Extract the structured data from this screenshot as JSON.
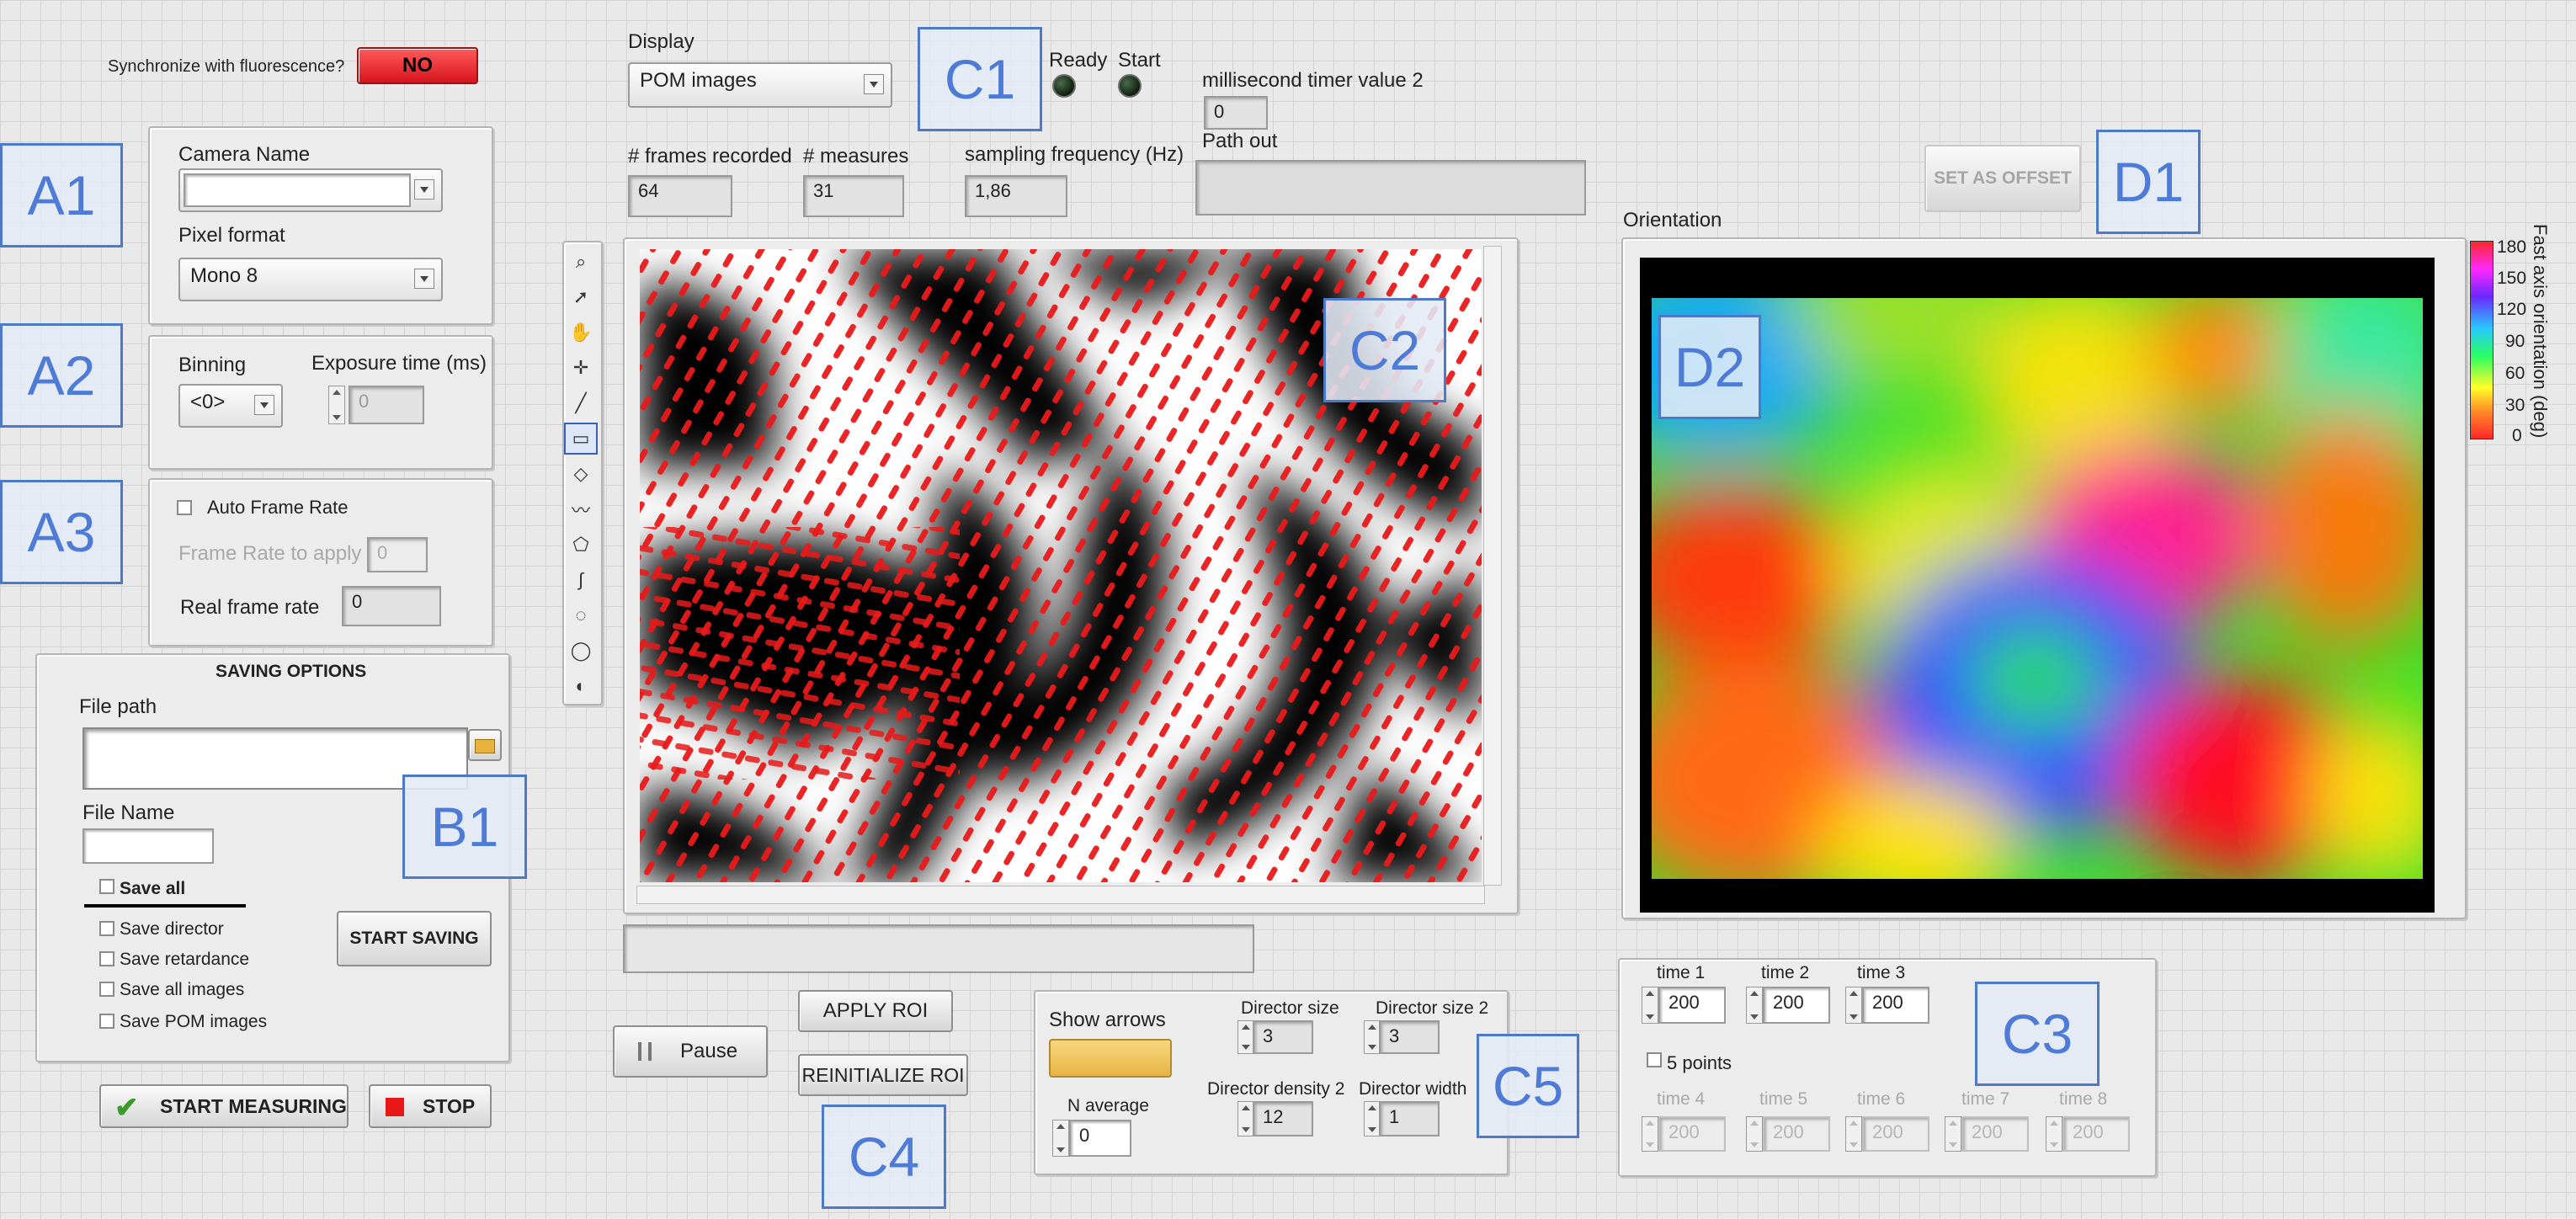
{
  "sync": {
    "label": "Synchronize with fluorescence?",
    "value": "NO",
    "color": "#e0202a"
  },
  "tags": {
    "A1": "A1",
    "A2": "A2",
    "A3": "A3",
    "B1": "B1",
    "C1": "C1",
    "C2": "C2",
    "C3": "C3",
    "C4": "C4",
    "C5": "C5",
    "D1": "D1",
    "D2": "D2"
  },
  "camera": {
    "camera_name_label": "Camera Name",
    "camera_name_value": "",
    "pixel_format_label": "Pixel format",
    "pixel_format_value": "Mono 8",
    "binning_label": "Binning",
    "binning_value": "<0>",
    "exposure_label": "Exposure time (ms)",
    "exposure_value": "0",
    "auto_frame_rate_label": "Auto Frame Rate",
    "frame_rate_apply_label": "Frame Rate to apply",
    "frame_rate_apply_value": "0",
    "real_frame_rate_label": "Real frame rate",
    "real_frame_rate_value": "0"
  },
  "saving": {
    "title": "SAVING OPTIONS",
    "file_path_label": "File path",
    "file_name_label": "File Name",
    "file_name_value": "",
    "save_all": "Save all",
    "save_director": "Save director",
    "save_retardance": "Save retardance",
    "save_all_images": "Save all images",
    "save_pom_images": "Save POM images",
    "start_saving": "START SAVING"
  },
  "controls": {
    "start_measuring": "START MEASURING",
    "stop": "STOP",
    "pause": "Pause",
    "apply_roi": "APPLY ROI",
    "reinit_roi": "REINITIALIZE ROI"
  },
  "display": {
    "label": "Display",
    "value": "POM images",
    "ready_label": "Ready",
    "start_label": "Start",
    "timer_label": "millisecond timer value 2",
    "timer_value": "0",
    "frames_label": "# frames recorded",
    "frames_value": "64",
    "measures_label": "# measures",
    "measures_value": "31",
    "sampling_label": "sampling frequency (Hz)",
    "sampling_value": "1,86",
    "path_out_label": "Path out",
    "set_offset": "SET AS OFFSET",
    "orientation_label": "Orientation",
    "colorbar_title": "Fast axis orientation (deg)",
    "colorbar_ticks": [
      "180",
      "150",
      "120",
      "90",
      "60",
      "30",
      "0"
    ]
  },
  "arrows": {
    "show_arrows": "Show arrows",
    "director_size_label": "Director size",
    "director_size_value": "3",
    "director_size2_label": "Director size 2",
    "director_size2_value": "3",
    "n_average_label": "N average",
    "n_average_value": "0",
    "density2_label": "Director density 2",
    "density2_value": "12",
    "width_label": "Director width",
    "width_value": "1",
    "toggle_color": "#f0c055"
  },
  "times": {
    "t1_label": "time 1",
    "t1": "200",
    "t2_label": "time 2",
    "t2": "200",
    "t3_label": "time 3",
    "t3": "200",
    "five_points": "5 points",
    "t4_label": "time 4",
    "t4": "200",
    "t5_label": "time 5",
    "t5": "200",
    "t6_label": "time 6",
    "t6": "200",
    "t7_label": "time 7",
    "t7": "200",
    "t8_label": "time 8",
    "t8": "200"
  }
}
